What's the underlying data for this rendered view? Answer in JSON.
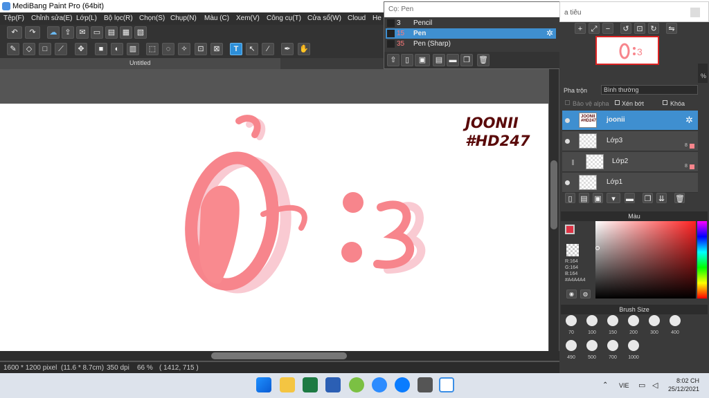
{
  "window": {
    "title": "MediBang Paint Pro (64bit)"
  },
  "menu": [
    "Tệp(F)",
    "Chỉnh sửa(E)",
    "Lớp(L)",
    "Bộ lọc(R)",
    "Chọn(S)",
    "Chụp(N)",
    "Màu (C)",
    "Xem(V)",
    "Công cụ(T)",
    "Cửa sổ(W)",
    "Cloud",
    "He"
  ],
  "document_tab": "Untitled",
  "canvas": {
    "signature_line1": "JOONII",
    "signature_line2": "#HD247",
    "drawing_text": "Ở :3"
  },
  "status": {
    "size": "1600 * 1200 pixel",
    "physical": "(11.6 * 8.7cm)",
    "dpi": "350 dpi",
    "zoom": "66 %",
    "coords": "( 1412, 715 )"
  },
  "brush_popup": {
    "header": "Cọ: Pen",
    "items": [
      {
        "num": "3",
        "name": "Pencil",
        "selected": false
      },
      {
        "num": "15",
        "name": "Pen",
        "selected": true
      },
      {
        "num": "35",
        "name": "Pen (Sharp)",
        "selected": false
      }
    ]
  },
  "navigator": {
    "title": "a tiêu"
  },
  "layers": {
    "blend_label": "Pha trộn",
    "blend_value": "Bình thường",
    "opacity_partial": "%",
    "protect_alpha": "Bảo vệ alpha",
    "clip": "Xén bớt",
    "lock": "Khóa",
    "items": [
      {
        "name": "joonii",
        "selected": true,
        "opacity": ""
      },
      {
        "name": "Lớp3",
        "selected": false,
        "opacity": "8"
      },
      {
        "name": "Lớp2",
        "selected": false,
        "opacity": "8"
      },
      {
        "name": "Lớp1",
        "selected": false,
        "opacity": ""
      }
    ]
  },
  "color_panel": {
    "title": "Màu",
    "r": "R:164",
    "g": "G:164",
    "b": "B:164",
    "hex": "#A4A4A4"
  },
  "brush_size": {
    "title": "Brush Size",
    "sizes": [
      "70",
      "100",
      "150",
      "200",
      "300",
      "400",
      "490",
      "500",
      "700",
      "1000"
    ]
  },
  "taskbar": {
    "lang": "VIE",
    "time": "8:02 CH",
    "date": "25/12/2021"
  },
  "colors": {
    "accent": "#3f8fd0",
    "drawing_pink": "#f7858c",
    "signature": "#5a0a0a"
  }
}
